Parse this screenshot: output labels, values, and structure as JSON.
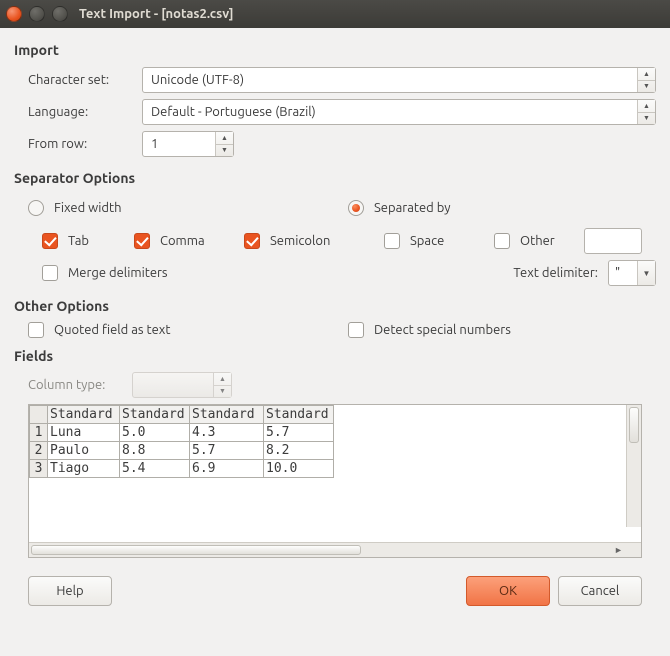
{
  "window": {
    "title": "Text Import - [notas2.csv]"
  },
  "sections": {
    "import": "Import",
    "separator": "Separator Options",
    "other": "Other Options",
    "fields": "Fields"
  },
  "import": {
    "charset_label": "Character set:",
    "charset_value": "Unicode (UTF-8)",
    "language_label": "Language:",
    "language_value": "Default - Portuguese (Brazil)",
    "fromrow_label": "From row:",
    "fromrow_value": "1"
  },
  "separator": {
    "fixed_width": {
      "label": "Fixed width",
      "selected": false
    },
    "separated_by": {
      "label": "Separated by",
      "selected": true
    },
    "options": {
      "tab": {
        "label": "Tab",
        "checked": true
      },
      "comma": {
        "label": "Comma",
        "checked": true
      },
      "semicolon": {
        "label": "Semicolon",
        "checked": true
      },
      "space": {
        "label": "Space",
        "checked": false
      },
      "other": {
        "label": "Other",
        "checked": false,
        "value": ""
      }
    },
    "merge": {
      "label": "Merge delimiters",
      "checked": false
    },
    "text_delimiter": {
      "label": "Text delimiter:",
      "value": "\""
    }
  },
  "other_options": {
    "quoted_as_text": {
      "label": "Quoted field as text",
      "checked": false
    },
    "detect_special": {
      "label": "Detect special numbers",
      "checked": false
    }
  },
  "fields": {
    "column_type_label": "Column type:",
    "column_type_value": "",
    "headers": [
      "Standard",
      "Standard",
      "Standard",
      "Standard"
    ],
    "rows": [
      {
        "n": "1",
        "cells": [
          "Luna",
          "5.0",
          "4.3",
          "5.7"
        ]
      },
      {
        "n": "2",
        "cells": [
          "Paulo",
          "8.8",
          "5.7",
          "8.2"
        ]
      },
      {
        "n": "3",
        "cells": [
          "Tiago",
          "5.4",
          "6.9",
          "10.0"
        ]
      }
    ]
  },
  "buttons": {
    "help": "Help",
    "ok": "OK",
    "cancel": "Cancel"
  }
}
